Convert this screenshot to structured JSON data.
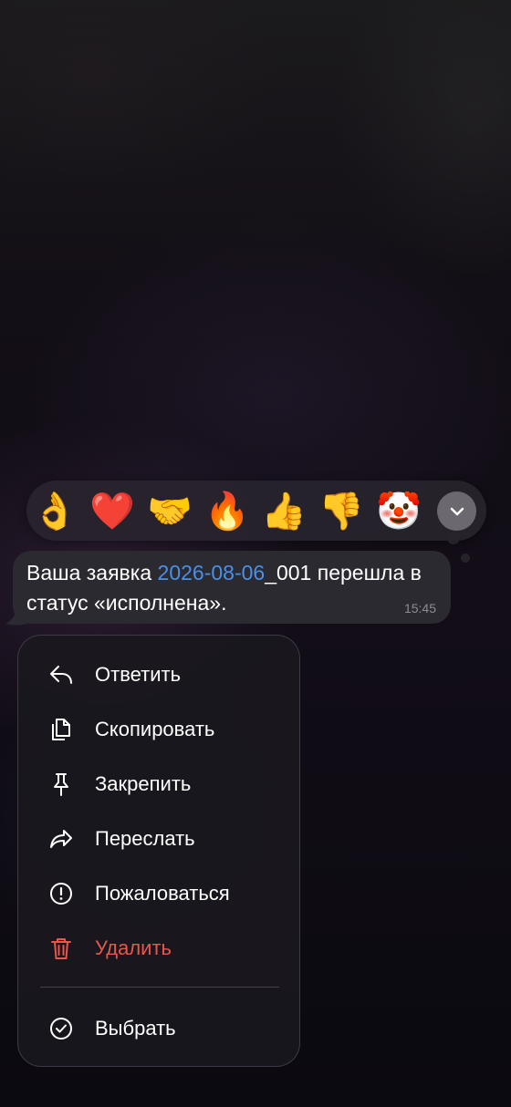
{
  "reactions": {
    "items": [
      {
        "emoji": "👌",
        "name": "ok-hand"
      },
      {
        "emoji": "❤️",
        "name": "red-heart"
      },
      {
        "emoji": "🤝",
        "name": "handshake"
      },
      {
        "emoji": "🔥",
        "name": "fire"
      },
      {
        "emoji": "👍",
        "name": "thumbs-up"
      },
      {
        "emoji": "👎",
        "name": "thumbs-down"
      },
      {
        "emoji": "🤡",
        "name": "clown-face"
      }
    ],
    "expand_icon": "chevron-down-icon"
  },
  "message": {
    "text_before_link": "Ваша заявка ",
    "link_text": "2026-08-06",
    "text_after_link": "_001 перешла в статус «исполнена».",
    "time": "15:45",
    "link_color": "#4a90e8"
  },
  "menu": {
    "items": [
      {
        "label": "Ответить",
        "icon": "reply-icon"
      },
      {
        "label": "Скопировать",
        "icon": "copy-icon"
      },
      {
        "label": "Закрепить",
        "icon": "pin-icon"
      },
      {
        "label": "Переслать",
        "icon": "forward-icon"
      },
      {
        "label": "Пожаловаться",
        "icon": "report-icon"
      },
      {
        "label": "Удалить",
        "icon": "trash-icon",
        "destructive": true
      }
    ],
    "select_item": {
      "label": "Выбрать",
      "icon": "check-circle-icon"
    },
    "destructive_color": "#e8574c"
  }
}
